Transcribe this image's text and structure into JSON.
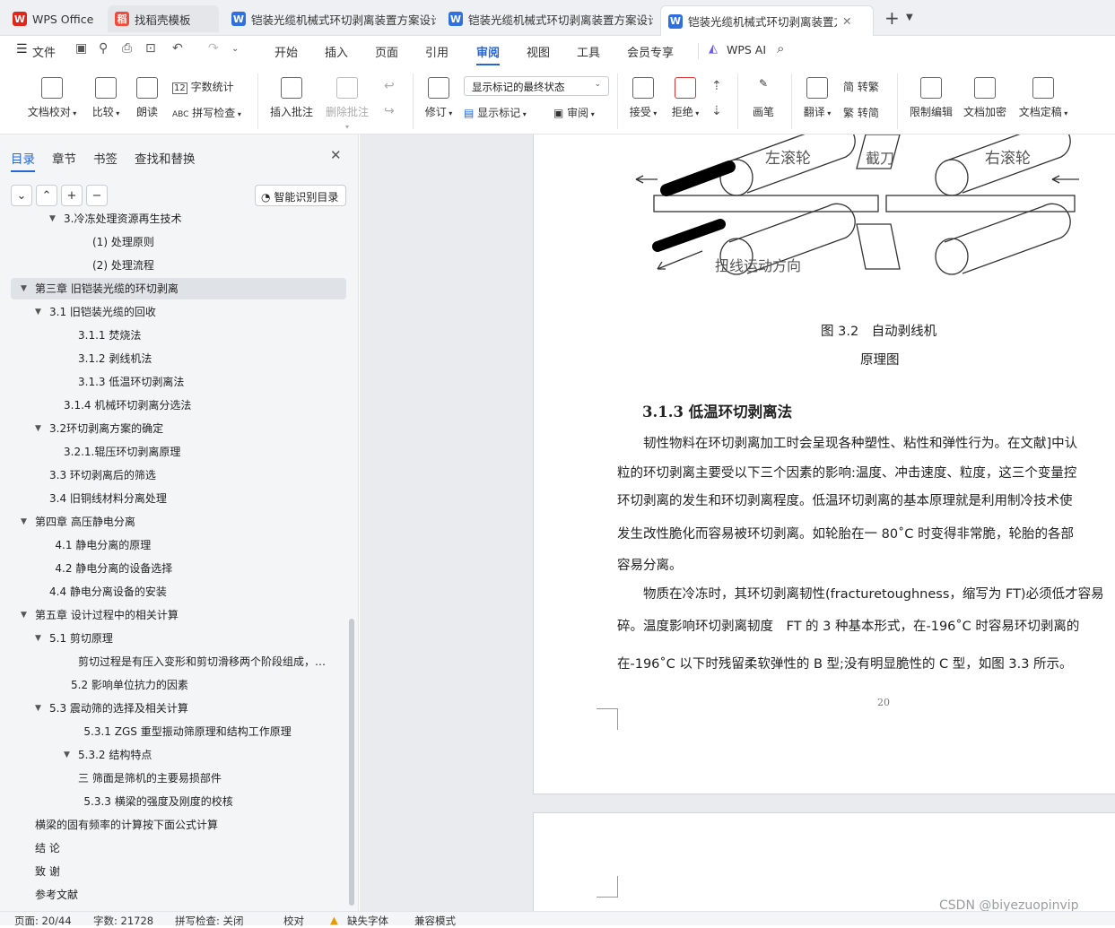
{
  "tabs": [
    {
      "label": "WPS Office",
      "icon": "wps-logo-icon"
    },
    {
      "label": "找稻壳模板",
      "icon": "docer-icon"
    },
    {
      "label": "铠装光缆机械式环切剥离装置方案设计",
      "icon": "writer-doc-icon"
    },
    {
      "label": "铠装光缆机械式环切剥离装置方案设计",
      "icon": "writer-doc-icon"
    },
    {
      "label": "铠装光缆机械式环切剥离装置方",
      "icon": "writer-doc-icon"
    }
  ],
  "menu": {
    "file": "文件",
    "items": [
      "开始",
      "插入",
      "页面",
      "引用",
      "审阅",
      "视图",
      "工具",
      "会员专享"
    ],
    "active": "审阅",
    "ai": "WPS AI"
  },
  "ribbon": {
    "doc_check": "文档校对",
    "compare": "比较",
    "read_aloud": "朗读",
    "word_count": "字数统计",
    "spell_check": "拼写检查",
    "insert_comment": "插入批注",
    "delete_comment": "删除批注",
    "revise": "修订",
    "markup_state": "显示标记的最终状态",
    "show_markup": "显示标记",
    "review_pane": "审阅",
    "accept": "接受",
    "reject": "拒绝",
    "pen": "画笔",
    "translate": "翻译",
    "to_traditional": "转繁",
    "to_simplified": "转简",
    "restrict_edit": "限制编辑",
    "encrypt": "文档加密",
    "finalize": "文档定稿"
  },
  "sidebar": {
    "tabs": [
      "目录",
      "章节",
      "书签",
      "查找和替换"
    ],
    "smart_toc": "智能识别目录",
    "toc": [
      {
        "label": "3.冷冻处理资源再生技术",
        "level": 2,
        "caret": true
      },
      {
        "label": "(1) 处理原则",
        "level": 4
      },
      {
        "label": "(2) 处理流程",
        "level": 4
      },
      {
        "label": "第三章 旧铠装光缆的环切剥离",
        "level": 0,
        "caret": true,
        "selected": true
      },
      {
        "label": "3.1 旧铠装光缆的回收",
        "level": 1,
        "caret": true
      },
      {
        "label": "3.1.1 焚烧法",
        "level": 3
      },
      {
        "label": "3.1.2 剥线机法",
        "level": 3
      },
      {
        "label": "3.1.3 低温环切剥离法",
        "level": 3
      },
      {
        "label": "3.1.4 机械环切剥离分选法",
        "level": 2
      },
      {
        "label": "3.2环切剥离方案的确定",
        "level": 1,
        "caret": true
      },
      {
        "label": "3.2.1.辊压环切剥离原理",
        "level": 2
      },
      {
        "label": "3.3 环切剥离后的筛选",
        "level": 1
      },
      {
        "label": "3.4 旧铜线材料分离处理",
        "level": 1
      },
      {
        "label": "第四章 高压静电分离",
        "level": 0,
        "caret": true
      },
      {
        "label": "4.1 静电分离的原理",
        "level": 1.4
      },
      {
        "label": "4.2 静电分离的设备选择",
        "level": 1.4
      },
      {
        "label": "4.4 静电分离设备的安装",
        "level": 1
      },
      {
        "label": "第五章 设计过程中的相关计算",
        "level": 0,
        "caret": true
      },
      {
        "label": "5.1 剪切原理",
        "level": 1,
        "caret": true
      },
      {
        "label": "剪切过程是有压入变形和剪切滑移两个阶段组成，剪切过程...",
        "level": 3
      },
      {
        "label": "5.2 影响单位抗力的因素",
        "level": 2.5
      },
      {
        "label": "5.3 震动筛的选择及相关计算",
        "level": 1,
        "caret": true
      },
      {
        "label": "5.3.1 ZGS 重型振动筛原理和结构工作原理",
        "level": 3.4
      },
      {
        "label": "5.3.2 结构特点",
        "level": 3,
        "caret": true
      },
      {
        "label": "三 筛面是筛机的主要易损部件",
        "level": 3
      },
      {
        "label": "5.3.3 横梁的强度及刚度的校核",
        "level": 3.4
      },
      {
        "label": "横梁的固有频率的计算按下面公式计算",
        "level": 0
      },
      {
        "label": "结 论",
        "level": 0
      },
      {
        "label": "致 谢",
        "level": 0
      },
      {
        "label": "参考文献",
        "level": 0
      }
    ]
  },
  "document": {
    "figure_labels": {
      "left_roller": "左滚轮",
      "cutter": "截刀",
      "right_roller": "右滚轮",
      "motion": "扭线运动方向"
    },
    "caption_line1": "图 3.2　自动剥线机",
    "caption_line2": "原理图",
    "heading": "3.1.3 低温环切剥离法",
    "paragraphs": [
      "　　韧性物料在环切剥离加工时会呈现各种塑性、粘性和弹性行为。在文献]中认",
      "粒的环切剥离主要受以下三个因素的影响:温度、冲击速度、粒度，这三个变量控",
      "环切剥离的发生和环切剥离程度。低温环切剥离的基本原理就是利用制冷技术使",
      "发生改性脆化而容易被环切剥离。如轮胎在一 80˚C 时变得非常脆，轮胎的各部",
      "容易分离。",
      "　　物质在冷冻时，其环切剥离韧性(fracturetoughness，缩写为 FT)必须低才容易",
      "碎。温度影响环切剥离韧度　FT 的 3 种基本形式，在-196˚C 时容易环切剥离的",
      "在-196˚C 以下时残留柔软弹性的 B 型;没有明显脆性的 C 型，如图 3.3 所示。"
    ],
    "page_number": "20",
    "watermark": "CSDN @biyezuopinvip"
  },
  "status": {
    "page": "页面: 20/44",
    "words": "字数: 21728",
    "spell": "拼写检查: 关闭",
    "proof": "校对",
    "missing_font": "缺失字体",
    "compat": "兼容模式"
  }
}
